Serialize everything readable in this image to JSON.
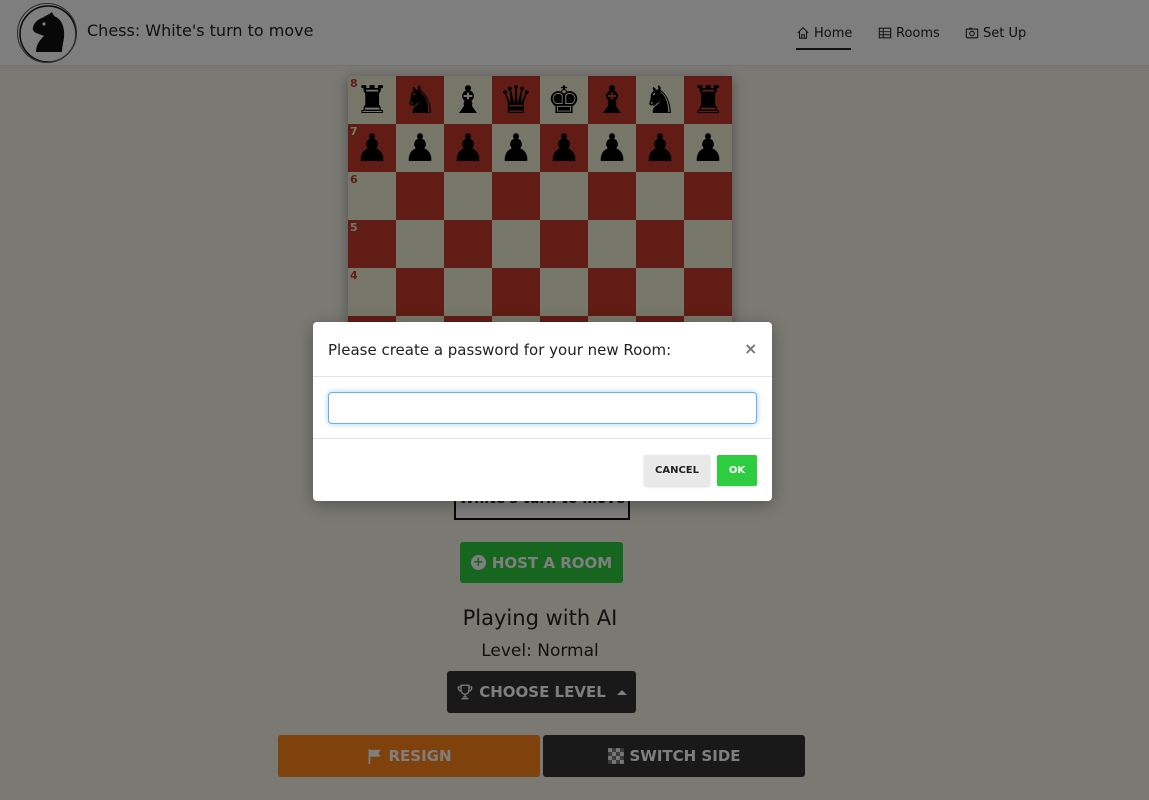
{
  "navbar": {
    "brand": "Chess: White's turn to move",
    "items": [
      {
        "label": "Home",
        "icon": "home-icon",
        "active": true
      },
      {
        "label": "Rooms",
        "icon": "table-icon",
        "active": false
      },
      {
        "label": "Set Up",
        "icon": "camera-icon",
        "active": false
      }
    ]
  },
  "board": {
    "ranks": [
      "8",
      "7",
      "6",
      "5",
      "4"
    ],
    "rank8": [
      "♜",
      "♞",
      "♝",
      "♛",
      "♚",
      "♝",
      "♞",
      "♜"
    ],
    "rank7": [
      "♟",
      "♟",
      "♟",
      "♟",
      "♟",
      "♟",
      "♟",
      "♟"
    ]
  },
  "turn_box": {
    "text": "White's turn to move"
  },
  "host_button": {
    "label": "HOST A ROOM",
    "icon": "plus-circle-icon"
  },
  "ai_panel": {
    "title": "Playing with AI",
    "level": "Level: Normal",
    "choose_label": "CHOOSE LEVEL",
    "choose_icon": "trophy-icon"
  },
  "actions": {
    "resign_label": "RESIGN",
    "resign_icon": "flag-icon",
    "switch_label": "SWITCH SIDE",
    "switch_icon": "checkerboard-icon"
  },
  "modal": {
    "title": "Please create a password for your new Room:",
    "close_glyph": "×",
    "input_value": "",
    "cancel_label": "CANCEL",
    "ok_label": "OK"
  },
  "colors": {
    "board_light": "#eeeed2",
    "board_dark": "#c0392b",
    "green": "#2ecc40",
    "orange": "#ff851b",
    "dark": "#333333"
  }
}
